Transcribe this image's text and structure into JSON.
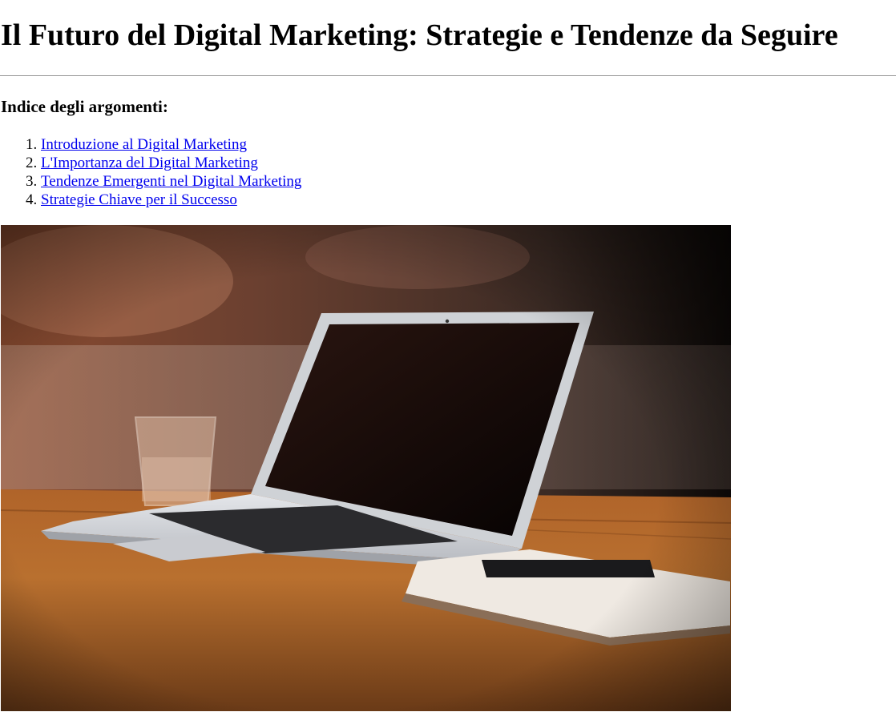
{
  "article": {
    "title": "Il Futuro del Digital Marketing: Strategie e Tendenze da Seguire"
  },
  "toc": {
    "heading": "Indice degli argomenti:",
    "items": [
      {
        "label": "Introduzione al Digital Marketing"
      },
      {
        "label": "L'Importanza del Digital Marketing"
      },
      {
        "label": "Tendenze Emergenti nel Digital Marketing"
      },
      {
        "label": "Strategie Chiave per il Successo"
      }
    ]
  },
  "hero": {
    "alt": "laptop-on-wooden-table-photo"
  },
  "colors": {
    "link": "#0000ee",
    "divider": "#999999"
  }
}
